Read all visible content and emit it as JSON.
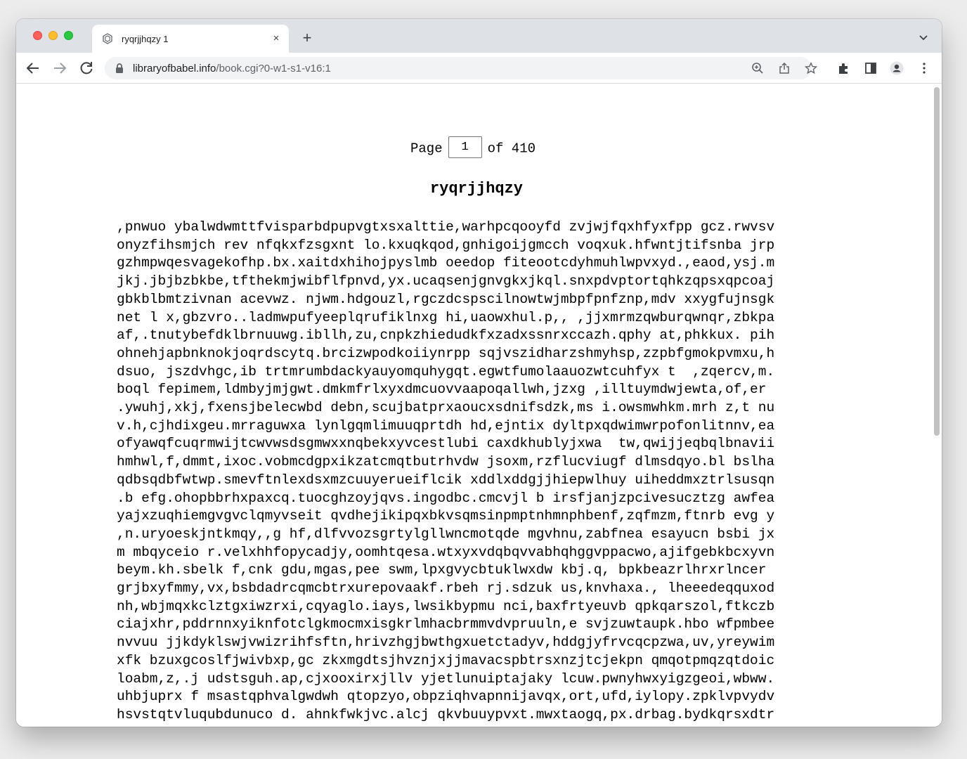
{
  "browser": {
    "tab": {
      "title": "ryqrjjhqzy 1",
      "close_label": "×"
    },
    "new_tab_label": "+",
    "address": {
      "host": "libraryofbabel.info",
      "path": "/book.cgi?0-w1-s1-v16:1"
    }
  },
  "page": {
    "page_label": "Page",
    "current_page": "1",
    "of_label": "of 410",
    "title": "ryqrjjhqzy",
    "lines": [
      ",pnwuo ybalwdwmttfvisparbdpupvgtxsxalttie,warhpcqooyfd zvjwjfqxhfyxfpp gcz.rwvsv",
      "onyzfihsmjch rev nfqkxfzsgxnt lo.kxuqkqod,gnhigoijgmcch voqxuk.hfwntjtifsnba jrp",
      "gzhmpwqesvagekofhp.bx.xaitdxhihojpyslmb oeedop fiteootcdyhmuhlwpvxyd.,eaod,ysj.m",
      "jkj.jbjbzbkbe,tfthekmjwibflfpnvd,yx.ucaqsenjgnvgkxjkql.snxpdvptortqhkzqpsxqpcoaj",
      "gbkblbmtzivnan acevwz. njwm.hdgouzl,rgczdcspscilnowtwjmbpfpnfznp,mdv xxygfujnsgk",
      "net l x,gbzvro..ladmwpufyeeplqrufiklnxg hi,uaowxhul.p,, ,jjxmrmzqwburqwnqr,zbkpa",
      "af,.tnutybefdklbrnuuwg.ibllh,zu,cnpkzhiedudkfxzadxssnrxccazh.qphy at,phkkux. pih",
      "ohnehjapbnknokjoqrdscytq.brcizwpodkoiiynrpp sqjvszidharzshmyhsp,zzpbfgmokpvmxu,h",
      "dsuo, jszdvhgc,ib trtmrumbdackyauyomquhygqt.egwtfumolaauozwtcuhfyx t  ,zqercv,m.",
      "boql fepimem,ldmbyjmjgwt.dmkmfrlxyxdmcuovvaapoqallwh,jzxg ,illtuymdwjewta,of,er",
      ".ywuhj,xkj,fxensjbelecwbd debn,scujbatprxaoucxsdnifsdzk,ms i.owsmwhkm.mrh z,t nu",
      "v.h,cjhdixgeu.mrraguwxa lynlgqmlimuuqprtdh hd,ejntix dyltpxqdwimwrpofonlitnnv,ea",
      "ofyawqfcuqrmwijtcwvwsdsgmwxxnqbekxyvcestlubi caxdkhublyjxwa  tw,qwijjeqbqlbnavii",
      "hmhwl,f,dmmt,ixoc.vobmcdgpxikzatcmqtbutrhvdw jsoxm,rzflucviugf dlmsdqyo.bl bslha",
      "qdbsqdbfwtwp.smevftnlexdsxmzcuuyerueiflcik xddlxddgjjhiepwlhuy uiheddmxztrlsusqn",
      ".b efg.ohopbbrhxpaxcq.tuocghzoyjqvs.ingodbc.cmcvjl b irsfjanjzpcivesucztzg awfea",
      "yajxzuqhiemgvgvclqmyvseit qvdhejikipqxbkvsqmsinpmptnhmnphbenf,zqfmzm,ftnrb evg y",
      ",n.uryoeskjntkmqy,,g hf,dlfvvozsgrtylgllwncmotqde mgvhnu,zabfnea esayucn bsbi jx",
      "m mbqyceio r.velxhhfopycadjy,oomhtqesa.wtxyxvdqbqvvabhqhggvppacwo,ajifgebkbcxyvn",
      "beym.kh.sbelk f,cnk gdu,mgas,pee swm,lpxgvycbtuklwxdw kbj.q, bpkbeazrlhrxrlncer",
      "grjbxyfmmy,vx,bsbdadrcqmcbtrxurepovaakf.rbeh rj.sdzuk us,knvhaxa., lheeedeqquxod",
      "nh,wbjmqxkclztgxiwzrxi,cqyaglo.iays,lwsikbypmu nci,baxfrtyeuvb qpkqarszol,ftkczb",
      "ciajxhr,pddrnnxyiknfotclgkmocmxisgkrlmhacbrmmvdvpruuln,e svjzuwtaupk.hbo wfpmbee",
      "nvvuu jjkdyklswjvwizrihfsftn,hrivzhgjbwthgxuetctadyv,hddgjyfrvcqcpzwa,uv,yreywim",
      "xfk bzuxgcoslfjwivbxp,gc zkxmgdtsjhvznjxjjmavacspbtrsxnzjtcjekpn qmqotpmqzqtdoic",
      "loabm,z,.j udstsguh.ap,cjxooxirxjllv yjetlunuiptajaky lcuw.pwnyhwxyigzgeoi,wbww.",
      "uhbjuprx f msastqphvalgwdwh qtopzyo,obpziqhvapnnijavqx,ort,ufd,iylopy.zpklvpvydv",
      "hsvstqtvluqubdunuco d. ahnkfwkjvc.alcj qkvbuuypvxt.mwxtaogq,px.drbag.bydkqrsxdtr"
    ]
  }
}
